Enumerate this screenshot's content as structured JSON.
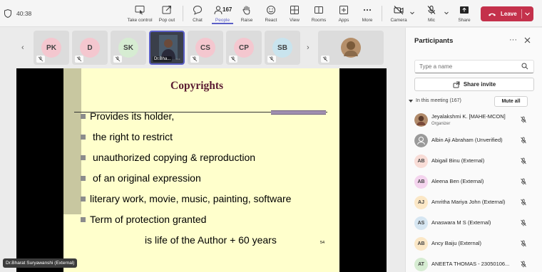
{
  "meeting": {
    "timer": "40:38",
    "toolbar": [
      {
        "label": "Take control",
        "icon": "take-control-icon"
      },
      {
        "label": "Pop out",
        "icon": "pop-out-icon"
      },
      {
        "label": "Chat",
        "icon": "chat-icon"
      },
      {
        "label": "People",
        "icon": "people-icon"
      },
      {
        "label": "Raise",
        "icon": "raise-hand-icon"
      },
      {
        "label": "React",
        "icon": "react-icon"
      },
      {
        "label": "View",
        "icon": "view-icon"
      },
      {
        "label": "Rooms",
        "icon": "rooms-icon"
      },
      {
        "label": "Apps",
        "icon": "apps-icon"
      },
      {
        "label": "More",
        "icon": "more-icon"
      },
      {
        "label": "Camera",
        "icon": "camera-off-icon"
      },
      {
        "label": "Mic",
        "icon": "mic-off-icon"
      },
      {
        "label": "Share",
        "icon": "share-icon"
      }
    ],
    "people_count": "167",
    "leave_label": "Leave",
    "accent": "#5b5fc7",
    "leave_color": "#c4314b"
  },
  "strip": {
    "tiles": [
      {
        "initials": "PK",
        "color": "#f4c7cf"
      },
      {
        "initials": "D",
        "color": "#f4c7cf"
      },
      {
        "initials": "SK",
        "color": "#d6ecd2"
      },
      {
        "initials": "Dr.Bha...",
        "color": "#3a3f4a"
      },
      {
        "initials": "CS",
        "color": "#f4c7cf"
      },
      {
        "initials": "CP",
        "color": "#f4c7cf"
      },
      {
        "initials": "SB",
        "color": "#c9e4ee"
      }
    ]
  },
  "slide": {
    "title": "Copyrights",
    "bullets": [
      "Provides its holder,",
      "the right to restrict",
      "unauthorized copying & reproduction",
      "of an original expression",
      "literary work, movie, music, painting, software",
      "Term of protection granted"
    ],
    "footer_line": "is life of the Author +  60 years",
    "page_number": "54"
  },
  "presenter_tag": "Dr.Bharat Suryawanshi (External)",
  "panel": {
    "title": "Participants",
    "search_placeholder": "Type a name",
    "share_invite": "Share invite",
    "in_meeting": "In this meeting (167)",
    "mute_all": "Mute all",
    "participants": [
      {
        "initials": "",
        "name": "Jeyalakshmi K. [MAHE-MCON]",
        "sub": "Organizer",
        "color": "#b08a6a",
        "photo": true
      },
      {
        "initials": "",
        "name": "Albin Aji Abraham (Unverified)",
        "sub": "",
        "color": "#9a9a9a",
        "photo": false
      },
      {
        "initials": "AB",
        "name": "Abigail Binu (External)",
        "sub": "",
        "color": "#f8dcd6"
      },
      {
        "initials": "AB",
        "name": "Aleena Ben (External)",
        "sub": "",
        "color": "#f4d4ee"
      },
      {
        "initials": "AJ",
        "name": "Amritha Mariya John (External)",
        "sub": "",
        "color": "#fbe7c6"
      },
      {
        "initials": "AS",
        "name": "Anaswara M S (External)",
        "sub": "",
        "color": "#d6e6f2"
      },
      {
        "initials": "AB",
        "name": "Ancy Baiju (External)",
        "sub": "",
        "color": "#fbe7c6"
      },
      {
        "initials": "AT",
        "name": "ANEETA THOMAS - 23050106...",
        "sub": "",
        "color": "#d6ecd2"
      }
    ]
  }
}
